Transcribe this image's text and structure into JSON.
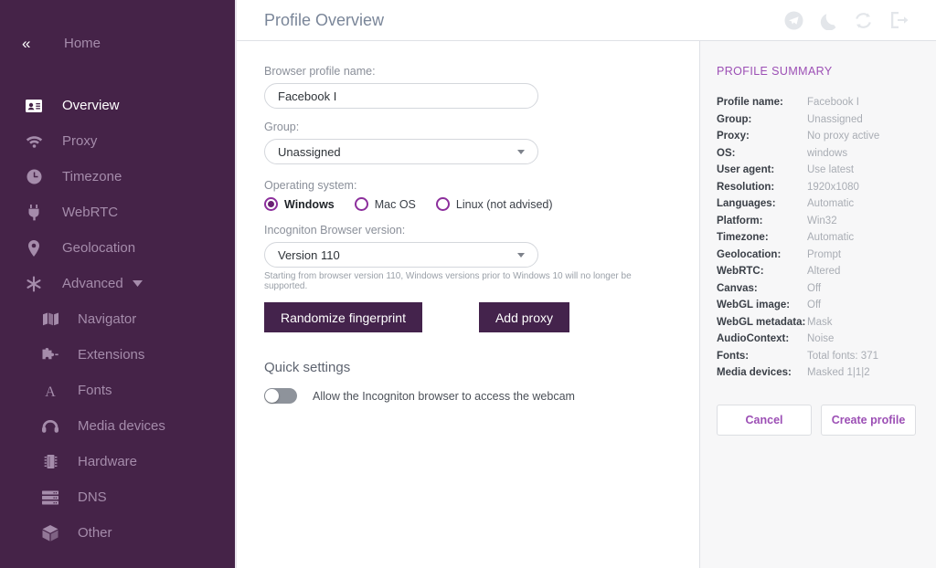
{
  "sidebar": {
    "collapse_icon": "double-chevron-left-icon",
    "home_label": "Home",
    "items": [
      {
        "label": "Overview",
        "icon": "contact-card-icon",
        "active": true
      },
      {
        "label": "Proxy",
        "icon": "wifi-icon",
        "active": false
      },
      {
        "label": "Timezone",
        "icon": "clock-icon",
        "active": false
      },
      {
        "label": "WebRTC",
        "icon": "plug-icon",
        "active": false
      },
      {
        "label": "Geolocation",
        "icon": "map-pin-icon",
        "active": false
      },
      {
        "label": "Advanced",
        "icon": "asterisk-icon",
        "active": false,
        "expandable": true
      }
    ],
    "sub_items": [
      {
        "label": "Navigator",
        "icon": "map-icon"
      },
      {
        "label": "Extensions",
        "icon": "puzzle-piece-icon"
      },
      {
        "label": "Fonts",
        "icon": "letter-a-icon"
      },
      {
        "label": "Media devices",
        "icon": "headphones-icon"
      },
      {
        "label": "Hardware",
        "icon": "chip-icon"
      },
      {
        "label": "DNS",
        "icon": "server-icon"
      },
      {
        "label": "Other",
        "icon": "box-icon"
      }
    ]
  },
  "header": {
    "title": "Profile Overview",
    "icons": [
      {
        "name": "telegram-icon"
      },
      {
        "name": "moon-icon"
      },
      {
        "name": "refresh-icon"
      },
      {
        "name": "logout-icon"
      }
    ]
  },
  "form": {
    "profile_name_label": "Browser profile name:",
    "profile_name_value": "Facebook I",
    "profile_name_placeholder": "Browser profile name",
    "group_label": "Group:",
    "group_value": "Unassigned",
    "os_label": "Operating system:",
    "os_options": [
      {
        "label": "Windows",
        "selected": true
      },
      {
        "label": "Mac OS",
        "selected": false
      },
      {
        "label": "Linux (not advised)",
        "selected": false
      }
    ],
    "version_label": "Incogniton Browser version:",
    "version_value": "Version 110",
    "version_hint": "Starting from browser version 110, Windows versions prior to Windows 10 will no longer be supported.",
    "randomize_button": "Randomize fingerprint",
    "add_proxy_button": "Add proxy",
    "quick_settings_title": "Quick settings",
    "webcam_toggle_label": "Allow the Incogniton browser to access the webcam",
    "webcam_toggle_on": false
  },
  "summary": {
    "title": "PROFILE SUMMARY",
    "rows": [
      {
        "key": "Profile name:",
        "value": "Facebook I"
      },
      {
        "key": "Group:",
        "value": "Unassigned"
      },
      {
        "key": "Proxy:",
        "value": "No proxy active"
      },
      {
        "key": "OS:",
        "value": "windows"
      },
      {
        "key": "User agent:",
        "value": "Use latest"
      },
      {
        "key": "Resolution:",
        "value": "1920x1080"
      },
      {
        "key": "Languages:",
        "value": "Automatic"
      },
      {
        "key": "Platform:",
        "value": "Win32"
      },
      {
        "key": "Timezone:",
        "value": "Automatic"
      },
      {
        "key": "Geolocation:",
        "value": "Prompt"
      },
      {
        "key": "WebRTC:",
        "value": "Altered"
      },
      {
        "key": "Canvas:",
        "value": "Off"
      },
      {
        "key": "WebGL image:",
        "value": "Off"
      },
      {
        "key": "WebGL metadata:",
        "value": "Mask"
      },
      {
        "key": "AudioContext:",
        "value": "Noise"
      },
      {
        "key": "Fonts:",
        "value": "Total fonts: 371"
      },
      {
        "key": "Media devices:",
        "value": "Masked 1|1|2"
      }
    ],
    "cancel_button": "Cancel",
    "create_button": "Create profile"
  },
  "colors": {
    "sidebar_bg": "#452348",
    "sidebar_text": "#a58cab",
    "accent_purple": "#9c4fb5",
    "button_purple": "#44234c",
    "radio_purple": "#8c2f9c",
    "summary_bg": "#f7f7f8"
  }
}
